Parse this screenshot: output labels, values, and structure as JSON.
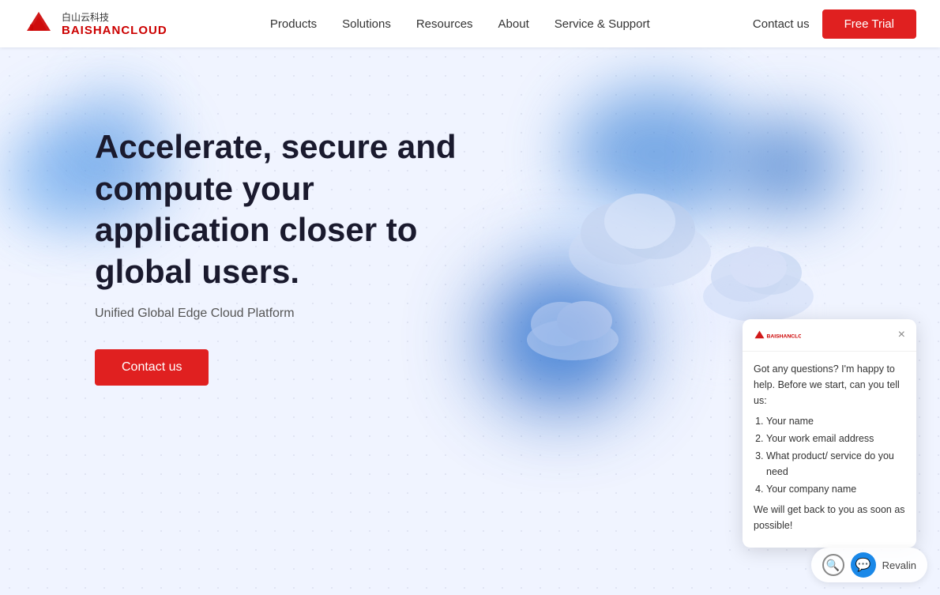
{
  "navbar": {
    "logo": {
      "cn_text": "白山云科技",
      "en_text": "BAISHANCLOUD"
    },
    "nav_items": [
      {
        "label": "Products",
        "id": "products"
      },
      {
        "label": "Solutions",
        "id": "solutions"
      },
      {
        "label": "Resources",
        "id": "resources"
      },
      {
        "label": "About",
        "id": "about"
      },
      {
        "label": "Service & Support",
        "id": "service-support"
      }
    ],
    "contact_label": "Contact us",
    "free_trial_label": "Free Trial"
  },
  "hero": {
    "title": "Accelerate, secure and compute your application closer to global users.",
    "subtitle": "Unified Global Edge Cloud Platform",
    "contact_btn_label": "Contact us"
  },
  "chat": {
    "intro": "Got any questions? I'm happy to help. Before we start, can you tell us:",
    "items": [
      "Your name",
      "Your work email address",
      "What product/ service do you need",
      "Your company name"
    ],
    "outro": "We will get back to you as soon as possible!",
    "close_label": "×"
  },
  "revalin": {
    "label": "Revalin"
  }
}
